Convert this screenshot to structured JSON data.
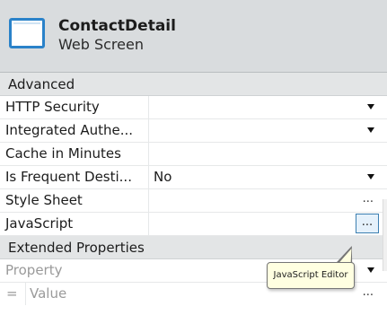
{
  "header": {
    "title": "ContactDetail",
    "subtitle": "Web Screen",
    "icon": "screen-icon",
    "accent_color": "#2a82c9"
  },
  "sections": {
    "advanced": {
      "label": "Advanced",
      "rows": [
        {
          "name": "HTTP Security",
          "value": "",
          "control": "dropdown"
        },
        {
          "name": "Integrated Authe...",
          "value": "",
          "control": "dropdown"
        },
        {
          "name": "Cache in Minutes",
          "value": "",
          "control": "text"
        },
        {
          "name": "Is Frequent Desti...",
          "value": "No",
          "control": "dropdown"
        },
        {
          "name": "Style Sheet",
          "value": "",
          "control": "ellipsis",
          "button_label": "..."
        },
        {
          "name": "JavaScript",
          "value": "",
          "control": "ellipsis",
          "button_label": "..."
        }
      ]
    },
    "extended": {
      "label": "Extended Properties",
      "property_placeholder": "Property",
      "value_prefix": "=",
      "value_placeholder": "Value",
      "value_button_label": "..."
    }
  },
  "tooltip": {
    "text": "JavaScript Editor"
  }
}
